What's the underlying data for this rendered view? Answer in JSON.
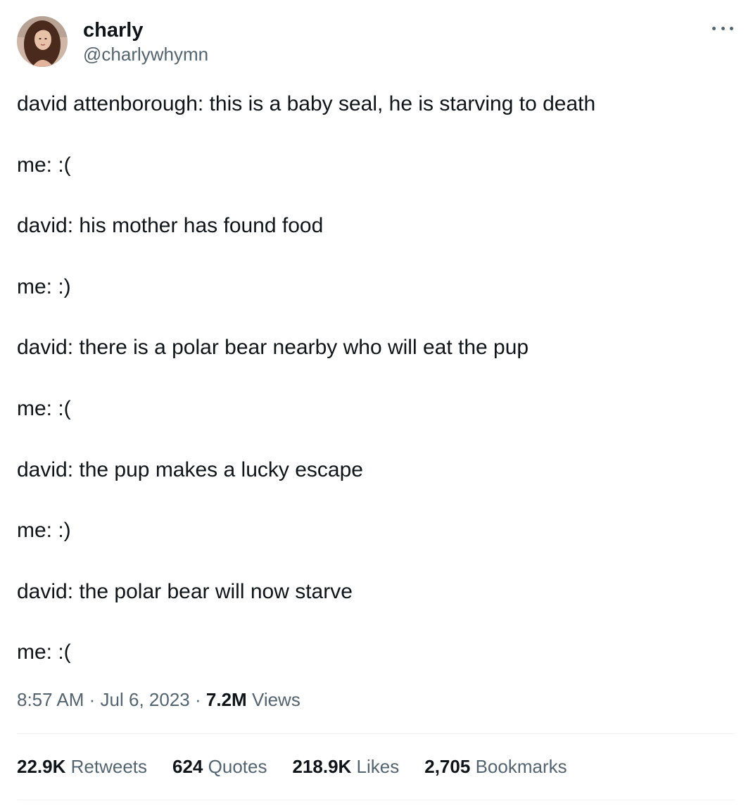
{
  "author": {
    "display_name": "charly",
    "handle": "@charlywhymn",
    "avatar": "profile-photo"
  },
  "menu_icon": "more-horizontal-icon",
  "tweet_lines": [
    "david attenborough: this is a baby seal, he is starving to death",
    "me: :(",
    "david: his mother has found food",
    "me: :)",
    "david: there is a polar bear nearby who will eat the pup",
    "me: :(",
    "david: the pup makes a lucky escape",
    "me: :)",
    "david: the polar bear will now starve",
    "me: :("
  ],
  "meta": {
    "time": "8:57 AM",
    "separator": "·",
    "date": "Jul 6, 2023",
    "views_count": "7.2M",
    "views_label": "Views"
  },
  "stats": {
    "retweets": {
      "count": "22.9K",
      "label": "Retweets"
    },
    "quotes": {
      "count": "624",
      "label": "Quotes"
    },
    "likes": {
      "count": "218.9K",
      "label": "Likes"
    },
    "bookmarks": {
      "count": "2,705",
      "label": "Bookmarks"
    }
  },
  "colors": {
    "text_primary": "#0f1419",
    "text_secondary": "#536471",
    "divider": "#eff3f4"
  }
}
